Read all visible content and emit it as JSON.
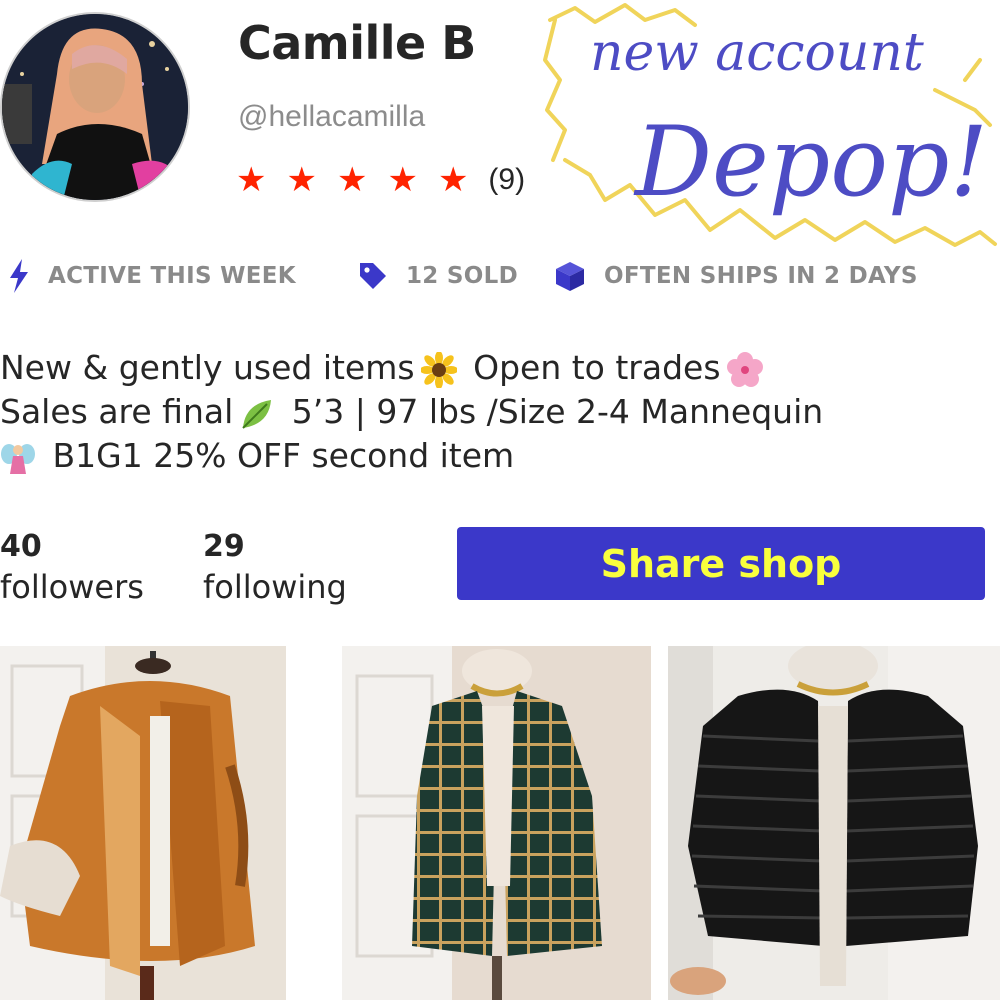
{
  "profile": {
    "name": "Camille B",
    "handle": "@hellacamilla",
    "rating_stars": 5,
    "rating_count": "(9)"
  },
  "sticker": {
    "line1": "new account",
    "line2": "Depop!"
  },
  "badges": [
    {
      "icon": "lightning-icon",
      "label": "ACTIVE THIS WEEK"
    },
    {
      "icon": "tag-icon",
      "label": "12 SOLD"
    },
    {
      "icon": "box-icon",
      "label": "OFTEN SHIPS IN 2 DAYS"
    }
  ],
  "bio": {
    "line1_a": "New & gently used items",
    "line1_b": "Open to trades",
    "line2_a": "Sales are final",
    "line2_b": "5’3 | 97 lbs /Size 2-4 Mannequin",
    "line3": "B1G1 25% OFF second item",
    "emojis": [
      "sunflower-emoji",
      "cherry-blossom-emoji",
      "leaf-emoji",
      "fairy-emoji"
    ]
  },
  "stats": {
    "followers_count": "40",
    "followers_label": "followers",
    "following_count": "29",
    "following_label": "following"
  },
  "share_button": {
    "label": "Share shop"
  },
  "colors": {
    "accent": "#3b38c9",
    "button_text": "#f9ff3d",
    "star": "#ff2300",
    "badge_icon": "#3b38c9",
    "badge_text": "#8a8a8a"
  },
  "products": [
    {
      "kind": "fox fur coat"
    },
    {
      "kind": "plaid wool coat"
    },
    {
      "kind": "black faux fur jacket"
    }
  ]
}
